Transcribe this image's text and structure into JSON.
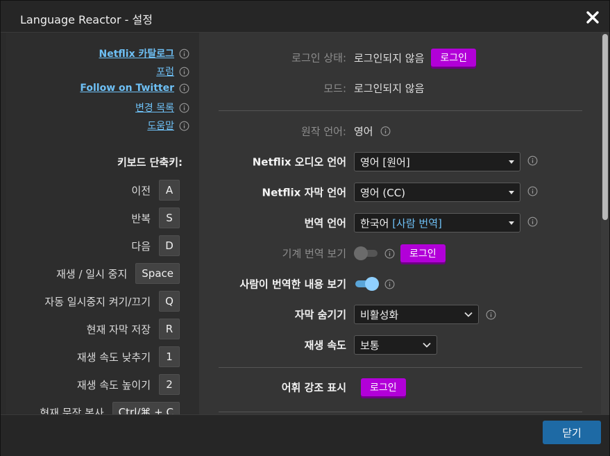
{
  "window": {
    "title": "Language Reactor - 설정"
  },
  "links": [
    {
      "label": "Netflix 카탈로그"
    },
    {
      "label": "포럼"
    },
    {
      "label": "Follow on Twitter"
    },
    {
      "label": "변경 목록"
    },
    {
      "label": "도움말"
    }
  ],
  "shortcuts": {
    "title": "키보드 단축키:",
    "items": [
      {
        "label": "이전",
        "key": "A"
      },
      {
        "label": "반복",
        "key": "S"
      },
      {
        "label": "다음",
        "key": "D"
      },
      {
        "label": "재생 / 일시 중지",
        "key": "Space"
      },
      {
        "label": "자동 일시중지 켜기/끄기",
        "key": "Q"
      },
      {
        "label": "현재 자막 저장",
        "key": "R"
      },
      {
        "label": "재생 속도 낮추기",
        "key": "1"
      },
      {
        "label": "재생 속도 높이기",
        "key": "2"
      },
      {
        "label": "현재 문장 복사",
        "key": "Ctrl/⌘ + C"
      }
    ]
  },
  "settings": {
    "login_status": {
      "label": "로그인 상태:",
      "value": "로그인되지 않음",
      "button": "로그인"
    },
    "mode": {
      "label": "모드:",
      "value": "로그인되지 않음"
    },
    "source_language": {
      "label": "원작 언어:",
      "value": "영어"
    },
    "audio_language": {
      "label": "Netflix 오디오 언어",
      "value": "영어 [원어]"
    },
    "subtitle_language": {
      "label": "Netflix 자막 언어",
      "value": "영어 (CC)"
    },
    "translation_language": {
      "label": "번역 언어",
      "value": "한국어",
      "value_accent": "[사람 번역]"
    },
    "machine_translation": {
      "label": "기계 번역 보기",
      "button": "로그인",
      "state": "off"
    },
    "human_translation": {
      "label": "사람이 번역한 내용 보기",
      "state": "on"
    },
    "hide_subtitles": {
      "label": "자막 숨기기",
      "value": "비활성화"
    },
    "playback_speed": {
      "label": "재생 속도",
      "value": "보통"
    },
    "vocab_highlight": {
      "label": "어휘 강조 표시",
      "button": "로그인"
    }
  },
  "footer": {
    "close_label": "닫기"
  },
  "colors": {
    "accent": "#6ec0f5",
    "login_button": "#b200d8",
    "primary_button": "#1e6aa5"
  }
}
